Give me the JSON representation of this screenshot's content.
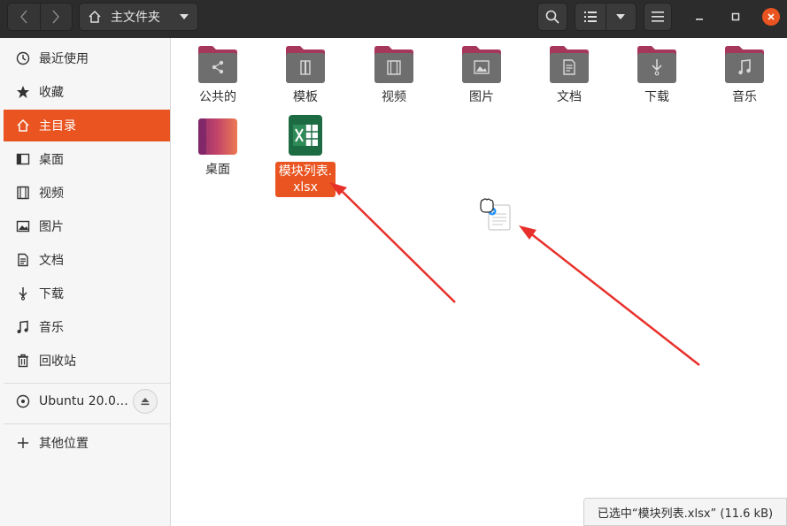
{
  "header": {
    "back_icon": "chevron-left-icon",
    "forward_icon": "chevron-right-icon",
    "path_label": "主文件夹",
    "path_icon": "home-icon"
  },
  "sidebar": {
    "items": [
      {
        "label": "最近使用",
        "icon": "clock-icon"
      },
      {
        "label": "收藏",
        "icon": "star-icon"
      },
      {
        "label": "主目录",
        "icon": "home-icon",
        "active": true
      },
      {
        "label": "桌面",
        "icon": "desktop-icon"
      },
      {
        "label": "视频",
        "icon": "video-icon"
      },
      {
        "label": "图片",
        "icon": "picture-icon"
      },
      {
        "label": "文档",
        "icon": "document-icon"
      },
      {
        "label": "下载",
        "icon": "download-icon"
      },
      {
        "label": "音乐",
        "icon": "music-icon"
      },
      {
        "label": "回收站",
        "icon": "trash-icon"
      }
    ],
    "device": {
      "label": "Ubuntu 20.0…",
      "icon": "disc-icon",
      "eject_icon": "eject-icon"
    },
    "other": {
      "label": "其他位置",
      "icon": "plus-icon"
    }
  },
  "files": [
    {
      "name": "公共的",
      "type": "folder",
      "emblem": "share-icon"
    },
    {
      "name": "模板",
      "type": "folder",
      "emblem": "template-icon"
    },
    {
      "name": "视频",
      "type": "folder",
      "emblem": "video-icon"
    },
    {
      "name": "图片",
      "type": "folder",
      "emblem": "picture-icon"
    },
    {
      "name": "文档",
      "type": "folder",
      "emblem": "document-icon"
    },
    {
      "name": "下载",
      "type": "folder",
      "emblem": "download-icon"
    },
    {
      "name": "音乐",
      "type": "folder",
      "emblem": "music-icon"
    },
    {
      "name": "桌面",
      "type": "desktop-folder"
    },
    {
      "name_line1": "模块列表.",
      "name_line2": "xlsx",
      "type": "spreadsheet",
      "selected": true
    }
  ],
  "status": {
    "text": "已选中“模块列表.xlsx” (11.6 kB)"
  },
  "colors": {
    "accent": "#e95420",
    "headerbar": "#2c2c2c",
    "folder": "#6e6e6e",
    "folder_tab": "#a4375a",
    "annotation_arrow": "#e8302a"
  }
}
